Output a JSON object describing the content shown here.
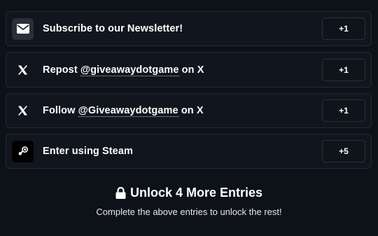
{
  "entries": [
    {
      "icon": "mail-icon",
      "prefix": "Subscribe to our Newsletter!",
      "handle": "",
      "suffix": "",
      "points": "+1"
    },
    {
      "icon": "x-logo-icon",
      "prefix": "Repost ",
      "handle": "@giveawaydotgame",
      "suffix": " on X",
      "points": "+1"
    },
    {
      "icon": "x-logo-icon",
      "prefix": "Follow ",
      "handle": "@Giveawaydotgame",
      "suffix": " on X",
      "points": "+1"
    },
    {
      "icon": "steam-icon",
      "prefix": "Enter using Steam",
      "handle": "",
      "suffix": "",
      "points": "+5"
    }
  ],
  "unlock": {
    "icon": "lock-icon",
    "title": "Unlock 4 More Entries",
    "subtitle": "Complete the above entries to unlock the rest!"
  }
}
